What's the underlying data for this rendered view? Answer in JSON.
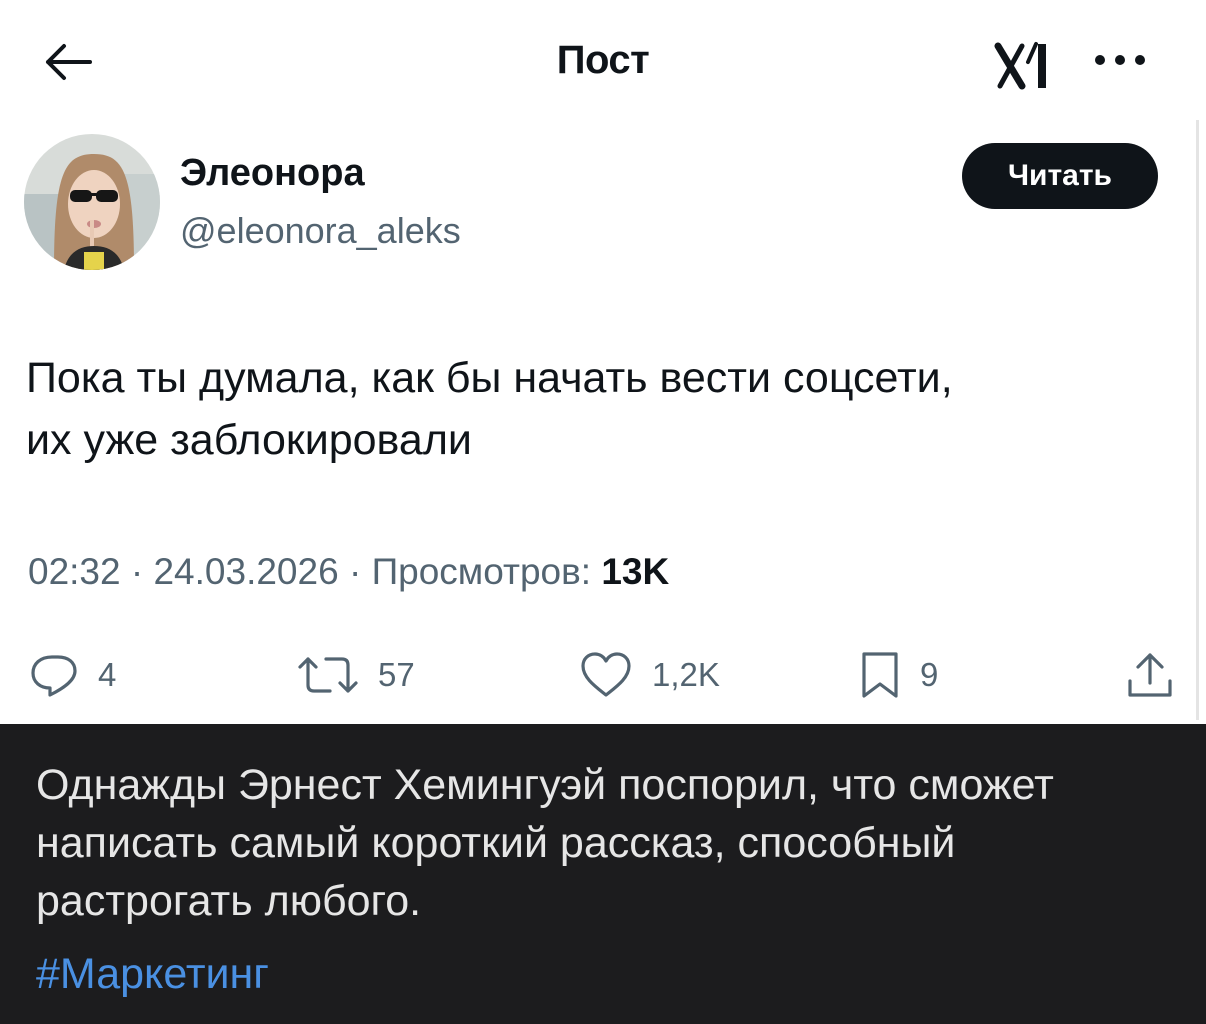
{
  "header": {
    "title": "Пост",
    "back_icon": "arrow-left-icon",
    "logo_icon": "x-logo-icon",
    "more_icon": "more-horizontal-icon"
  },
  "author": {
    "name": "Элеонора",
    "handle": "@eleonora_aleks",
    "follow_label": "Читать"
  },
  "post": {
    "text_line1": "Пока ты думала, как бы начать вести соцсети,",
    "text_line2": "их уже заблокировали",
    "time": "02:32",
    "date": "24.03.2026",
    "views_label": "Просмотров:",
    "views_count": "13K"
  },
  "actions": {
    "replies": "4",
    "reposts": "57",
    "likes": "1,2K",
    "bookmarks": "9"
  },
  "caption": {
    "line1": "Однажды Эрнест Хемингуэй поспорил, что сможет",
    "line2": "написать самый короткий рассказ, способный",
    "line3": "растрогать любого.",
    "hashtag": "#Маркетинг"
  },
  "colors": {
    "text": "#0f1419",
    "secondary": "#536471",
    "caption_bg": "#1c1c1e",
    "hashtag": "#4a90e2"
  }
}
